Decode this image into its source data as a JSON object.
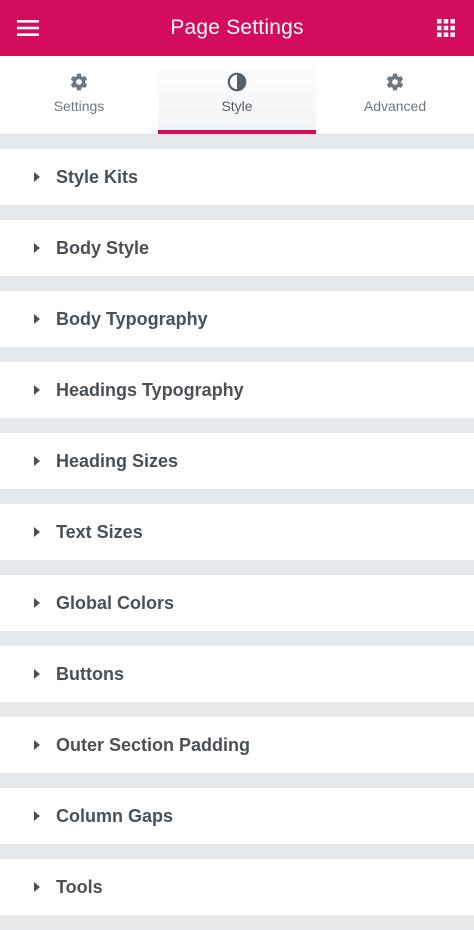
{
  "header": {
    "title": "Page Settings",
    "menu_icon": "hamburger-menu-icon",
    "apps_icon": "grid-apps-icon",
    "background_color": "#d30c5c"
  },
  "tabs": [
    {
      "label": "Settings",
      "icon": "gear-icon",
      "active": false
    },
    {
      "label": "Style",
      "icon": "half-circle-contrast-icon",
      "active": true
    },
    {
      "label": "Advanced",
      "icon": "gear-icon",
      "active": false
    }
  ],
  "sections": [
    {
      "label": "Style Kits"
    },
    {
      "label": "Body Style"
    },
    {
      "label": "Body Typography"
    },
    {
      "label": "Headings Typography"
    },
    {
      "label": "Heading Sizes"
    },
    {
      "label": "Text Sizes"
    },
    {
      "label": "Global Colors"
    },
    {
      "label": "Buttons"
    },
    {
      "label": "Outer Section Padding"
    },
    {
      "label": "Column Gaps"
    },
    {
      "label": "Tools"
    }
  ],
  "colors": {
    "accent": "#d30c5c",
    "section_text": "#495157",
    "tab_text": "#6d7882",
    "page_bg": "#e6e9ec"
  }
}
